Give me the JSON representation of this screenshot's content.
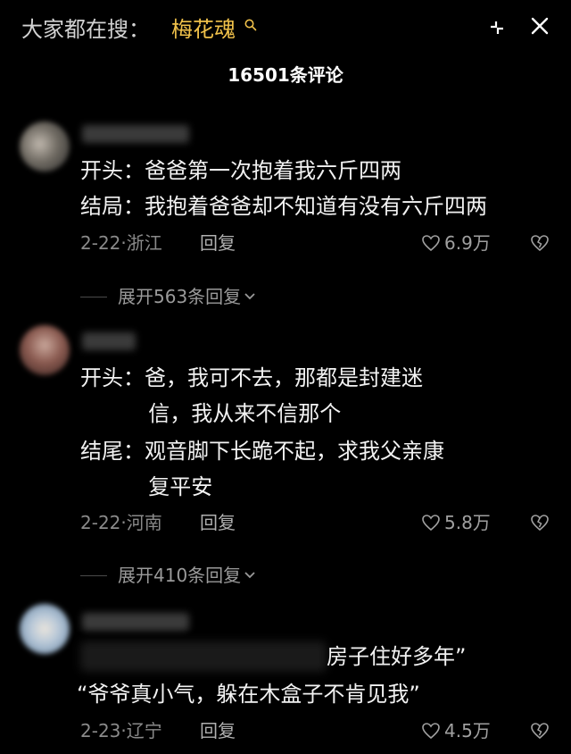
{
  "search": {
    "prefix": "大家都在搜：",
    "keyword": "梅花魂",
    "keyword_icon": "search-icon",
    "shrink_icon": "shrink-icon",
    "close_icon": "close-icon"
  },
  "comments_header": {
    "title": "16501条评论"
  },
  "comments": [
    {
      "lines": [
        "开头：爸爸第一次抱着我六斤四两",
        "结局：我抱着爸爸却不知道有没有六斤四两"
      ],
      "date_location": "2-22·浙江",
      "reply_label": "回复",
      "likes": "6.9万",
      "expand_label": "展开563条回复"
    },
    {
      "lines": [
        "开头：爸，我可不去，那都是封建迷",
        "          信，我从来不信那个",
        "结尾：观音脚下长跪不起，求我父亲康",
        "          复平安"
      ],
      "date_location": "2-22·河南",
      "reply_label": "回复",
      "likes": "5.8万",
      "expand_label": "展开410条回复"
    },
    {
      "lines": [
        "房子住好多年”",
        "“爷爷真小气，躲在木盒子不肯见我”"
      ],
      "date_location": "2-23·辽宁",
      "reply_label": "回复",
      "likes": "4.5万"
    }
  ],
  "colors": {
    "background": "#000000",
    "keyword": "#f0c14a",
    "text": "#f2f2f2",
    "muted": "#8a8a8a"
  }
}
